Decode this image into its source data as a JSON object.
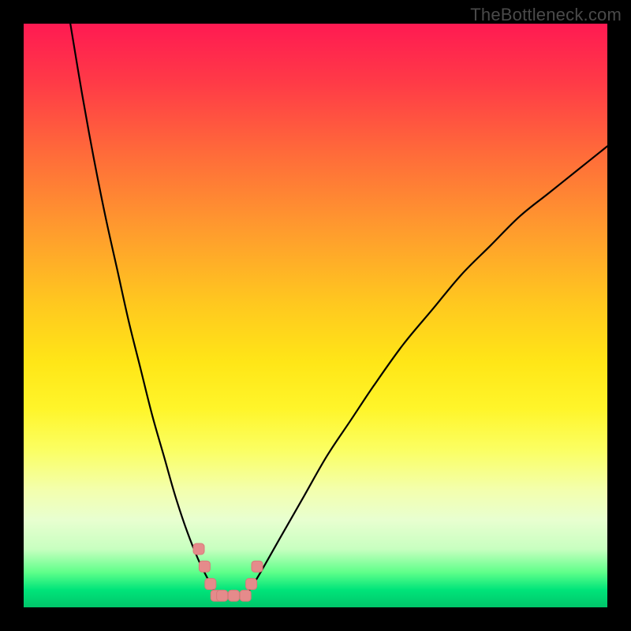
{
  "watermark": "TheBottleneck.com",
  "colors": {
    "curve_stroke": "#000000",
    "marker_fill": "#e58b8b",
    "marker_stroke": "#d97a7a",
    "frame": "#000000"
  },
  "chart_data": {
    "type": "line",
    "title": "",
    "xlabel": "",
    "ylabel": "",
    "xlim": [
      0,
      100
    ],
    "ylim": [
      0,
      100
    ],
    "series": [
      {
        "name": "left-branch",
        "x": [
          8,
          10,
          12,
          14,
          16,
          18,
          20,
          22,
          24,
          26,
          28,
          30,
          32,
          33
        ],
        "y": [
          100,
          88,
          77,
          67,
          58,
          49,
          41,
          33,
          26,
          19,
          13,
          8,
          4,
          2
        ]
      },
      {
        "name": "right-branch",
        "x": [
          38,
          40,
          44,
          48,
          52,
          56,
          60,
          65,
          70,
          75,
          80,
          85,
          90,
          95,
          100
        ],
        "y": [
          2,
          5,
          12,
          19,
          26,
          32,
          38,
          45,
          51,
          57,
          62,
          67,
          71,
          75,
          79
        ]
      }
    ],
    "markers": {
      "name": "highlight-markers",
      "points": [
        {
          "x": 30,
          "y": 10
        },
        {
          "x": 31,
          "y": 7
        },
        {
          "x": 32,
          "y": 4
        },
        {
          "x": 33,
          "y": 2
        },
        {
          "x": 34,
          "y": 2
        },
        {
          "x": 36,
          "y": 2
        },
        {
          "x": 38,
          "y": 2
        },
        {
          "x": 39,
          "y": 4
        },
        {
          "x": 40,
          "y": 7
        }
      ]
    }
  }
}
